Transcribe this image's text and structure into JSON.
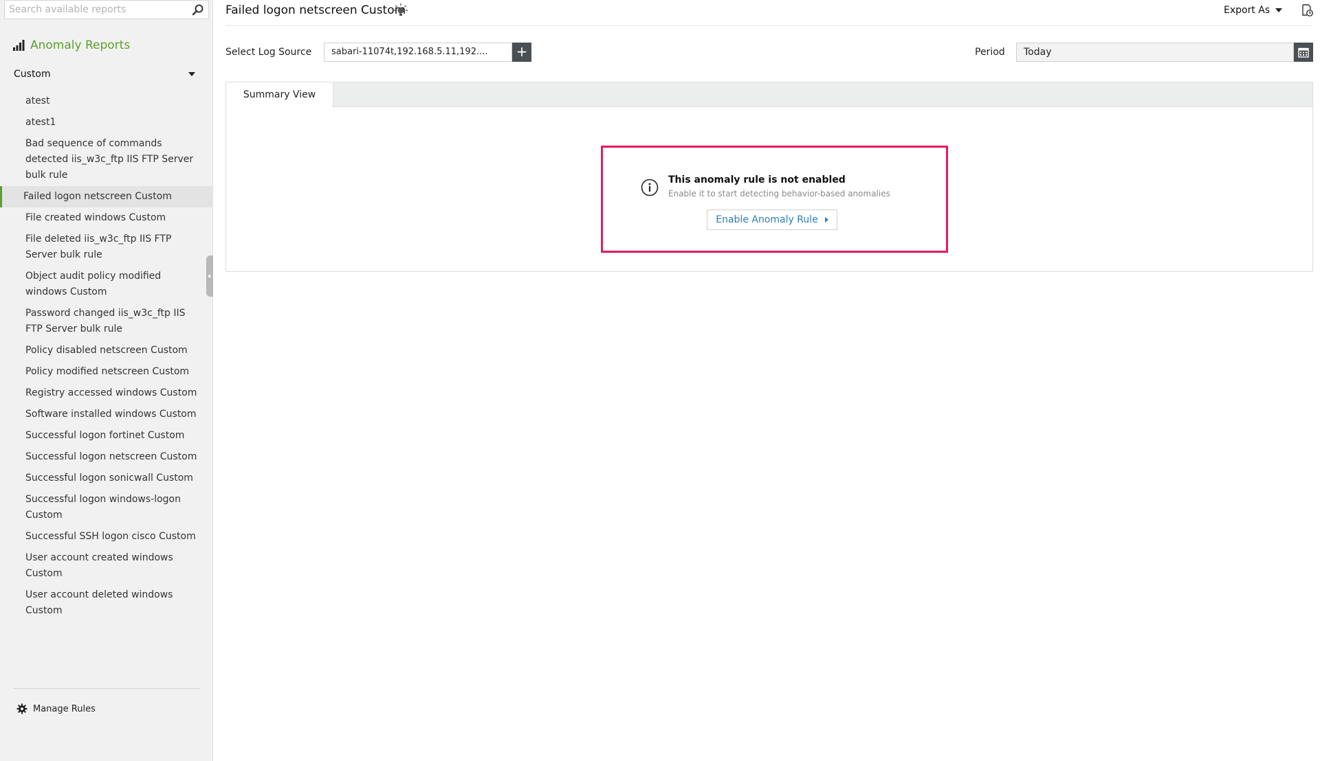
{
  "sidebar": {
    "search_placeholder": "Search available reports",
    "section_title": "Anomaly Reports",
    "category": "Custom",
    "reports": [
      "atest",
      "atest1",
      "Bad sequence of commands detected iis_w3c_ftp IIS FTP Server bulk rule",
      "Failed logon netscreen Custom",
      "File created windows Custom",
      "File deleted iis_w3c_ftp IIS FTP Server bulk rule",
      "Object audit policy modified windows Custom",
      "Password changed iis_w3c_ftp IIS FTP Server bulk rule",
      "Policy disabled netscreen Custom",
      "Policy modified netscreen Custom",
      "Registry accessed windows Custom",
      "Software installed windows Custom",
      "Successful logon fortinet Custom",
      "Successful logon netscreen Custom",
      "Successful logon sonicwall Custom",
      "Successful logon windows-logon Custom",
      "Successful SSH logon cisco Custom",
      "User account created windows Custom",
      "User account deleted windows Custom"
    ],
    "active_report_index": 3,
    "manage_rules_label": "Manage Rules",
    "accent_color": "#5aa02c"
  },
  "header": {
    "title": "Failed logon netscreen Custom",
    "export_label": "Export As"
  },
  "filters": {
    "log_source_label": "Select Log Source",
    "log_source_value": "sabari-11074t,192.168.5.11,192....",
    "period_label": "Period",
    "period_value": "Today"
  },
  "tabs": {
    "summary_label": "Summary View"
  },
  "notice": {
    "title": "This anomaly rule is not enabled",
    "subtitle": "Enable it to start detecting behavior-based anomalies",
    "button_label": "Enable Anomaly Rule",
    "border_color": "#e5195e"
  }
}
